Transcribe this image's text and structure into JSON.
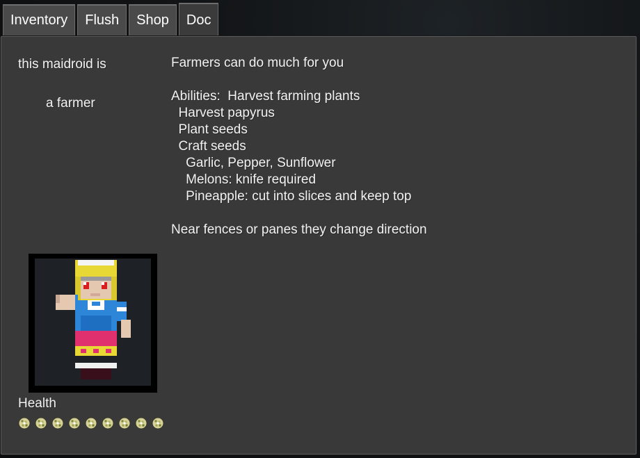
{
  "tabs": [
    {
      "label": "Inventory",
      "active": false
    },
    {
      "label": "Flush",
      "active": false
    },
    {
      "label": "Shop",
      "active": false
    },
    {
      "label": "Doc",
      "active": true
    }
  ],
  "left": {
    "intro": "this maidroid is",
    "role": "a farmer",
    "health_label": "Health",
    "health_icons": 9
  },
  "doc": {
    "lines": [
      "Farmers can do much for you",
      "",
      "Abilities:  Harvest farming plants",
      "  Harvest papyrus",
      "  Plant seeds",
      "  Craft seeds",
      "    Garlic, Pepper, Sunflower",
      "    Melons: knife required",
      "    Pineapple: cut into slices and keep top",
      "",
      "Near fences or panes they change direction"
    ]
  },
  "colors": {
    "panel": "#393939",
    "tab": "#4a4a4a",
    "text": "#f2f2f2"
  }
}
